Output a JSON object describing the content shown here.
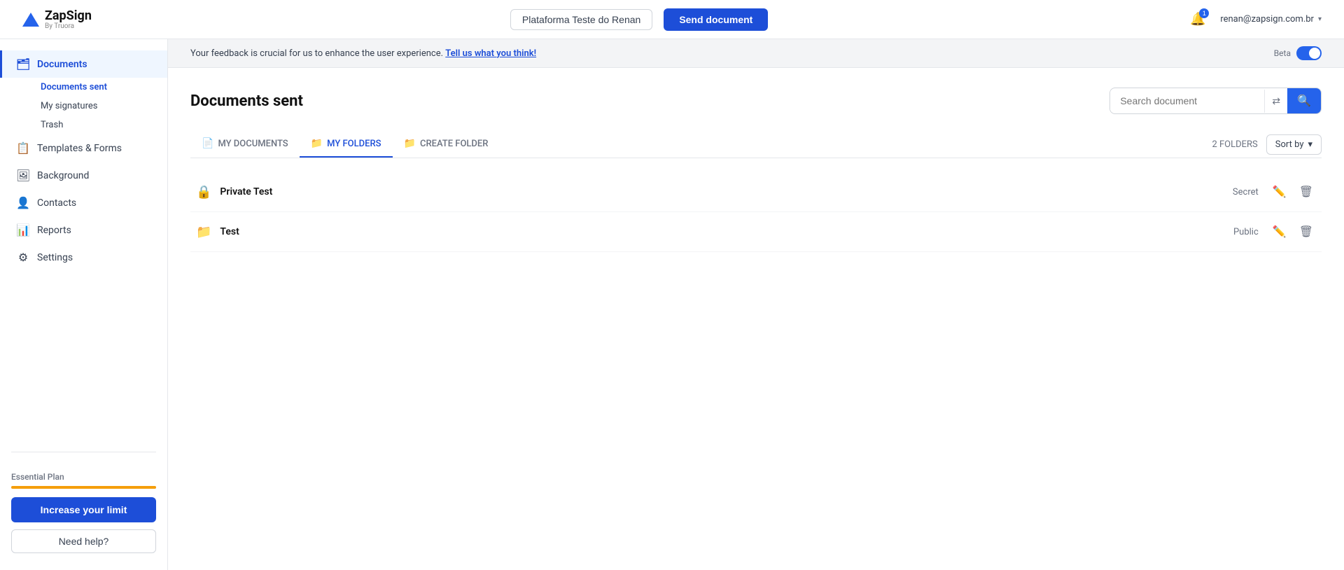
{
  "topnav": {
    "logo_text": "ZapSign",
    "logo_sub": "By Truora",
    "workspace_label": "Plataforma Teste do Renan",
    "send_doc_label": "Send document",
    "notification_count": "1",
    "user_email": "renan@zapsign.com.br"
  },
  "sidebar": {
    "items": [
      {
        "id": "documents",
        "label": "Documents",
        "icon": "🗂"
      },
      {
        "id": "templates",
        "label": "Templates & Forms",
        "icon": "📋"
      },
      {
        "id": "background",
        "label": "Background",
        "icon": "🖼"
      },
      {
        "id": "contacts",
        "label": "Contacts",
        "icon": "👤"
      },
      {
        "id": "reports",
        "label": "Reports",
        "icon": "📊"
      },
      {
        "id": "settings",
        "label": "Settings",
        "icon": "⚙"
      }
    ],
    "sub_items": [
      {
        "id": "documents-sent",
        "label": "Documents sent"
      },
      {
        "id": "my-signatures",
        "label": "My signatures"
      },
      {
        "id": "trash",
        "label": "Trash"
      }
    ],
    "plan_label": "Essential Plan",
    "increase_limit_label": "Increase your limit",
    "need_help_label": "Need help?"
  },
  "feedback": {
    "text": "Your feedback is crucial for us to enhance the user experience.",
    "link_text": "Tell us what you think!",
    "beta_label": "Beta"
  },
  "main": {
    "page_title": "Documents sent",
    "search_placeholder": "Search document",
    "tabs": [
      {
        "id": "my-documents",
        "label": "MY DOCUMENTS",
        "icon": "📄",
        "active": false
      },
      {
        "id": "my-folders",
        "label": "MY FOLDERS",
        "icon": "📁",
        "active": true
      },
      {
        "id": "create-folder",
        "label": "CREATE FOLDER",
        "icon": "📁",
        "active": false
      }
    ],
    "folders_count": "2 FOLDERS",
    "sort_by_label": "Sort by",
    "folders": [
      {
        "id": "private-test",
        "name": "Private Test",
        "visibility": "Secret",
        "icon": "🔒"
      },
      {
        "id": "test",
        "name": "Test",
        "visibility": "Public",
        "icon": "📁"
      }
    ]
  }
}
